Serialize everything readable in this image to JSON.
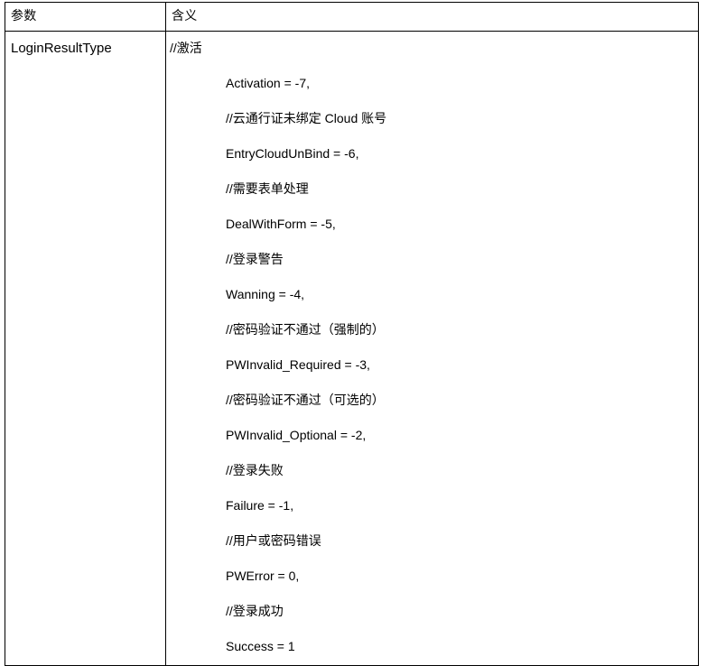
{
  "table": {
    "headers": [
      {
        "label": "参数"
      },
      {
        "label": "含义"
      }
    ],
    "rows": [
      {
        "param": "LoginResultType",
        "meaning_lines": [
          {
            "text": "//激活",
            "indent": 0
          },
          {
            "text": "Activation = -7,",
            "indent": 1
          },
          {
            "text": "//云通行证未绑定 Cloud 账号",
            "indent": 1
          },
          {
            "text": "EntryCloudUnBind = -6,",
            "indent": 1
          },
          {
            "text": "//需要表单处理",
            "indent": 1
          },
          {
            "text": "DealWithForm = -5,",
            "indent": 1
          },
          {
            "text": "//登录警告",
            "indent": 1
          },
          {
            "text": "Wanning = -4,",
            "indent": 1
          },
          {
            "text": "//密码验证不通过（强制的）",
            "indent": 1
          },
          {
            "text": "PWInvalid_Required = -3,",
            "indent": 1
          },
          {
            "text": "//密码验证不通过（可选的）",
            "indent": 1
          },
          {
            "text": "PWInvalid_Optional = -2,",
            "indent": 1
          },
          {
            "text": "//登录失败",
            "indent": 1
          },
          {
            "text": "Failure = -1,",
            "indent": 1
          },
          {
            "text": "//用户或密码错误",
            "indent": 1
          },
          {
            "text": "PWError = 0,",
            "indent": 1
          },
          {
            "text": "//登录成功",
            "indent": 1
          },
          {
            "text": "Success = 1",
            "indent": 1
          }
        ]
      }
    ]
  },
  "colors": {
    "border": "#000000",
    "text": "#000000",
    "background": "#ffffff"
  }
}
